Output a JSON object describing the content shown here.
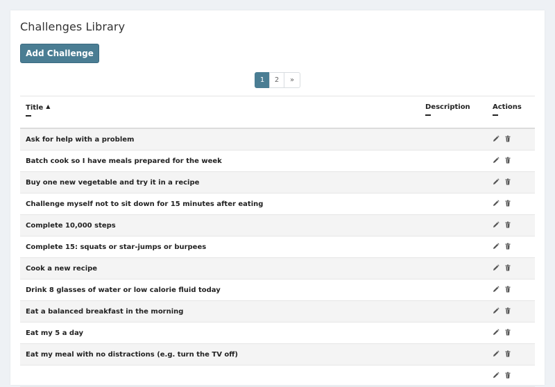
{
  "page": {
    "title": "Challenges Library"
  },
  "toolbar": {
    "add_label": "Add Challenge"
  },
  "pagination": {
    "pages": [
      "1",
      "2"
    ],
    "next": "»",
    "active": "1"
  },
  "table": {
    "columns": {
      "title": "Title",
      "description": "Description",
      "actions": "Actions"
    },
    "sort": {
      "column": "title",
      "direction": "ascending"
    },
    "rows": [
      "Ask for help with a problem",
      "Batch cook so I have meals prepared for the week",
      "Buy one new vegetable and try it in a recipe",
      "Challenge myself not to sit down for 15 minutes after eating",
      "Complete 10,000 steps",
      "Complete 15: squats or star-jumps or burpees",
      "Cook a new recipe",
      "Drink 8 glasses of water or low calorie fluid today",
      "Eat a balanced breakfast in the morning",
      "Eat my 5 a day",
      "Eat my meal with no distractions (e.g. turn the TV off)",
      ""
    ],
    "row_actions": {
      "edit_icon": "pencil-icon",
      "delete_icon": "trash-icon"
    }
  },
  "colors": {
    "accent": "#4a7d93",
    "page_bg": "#eef1f5",
    "stripe": "#f4f4f4"
  }
}
